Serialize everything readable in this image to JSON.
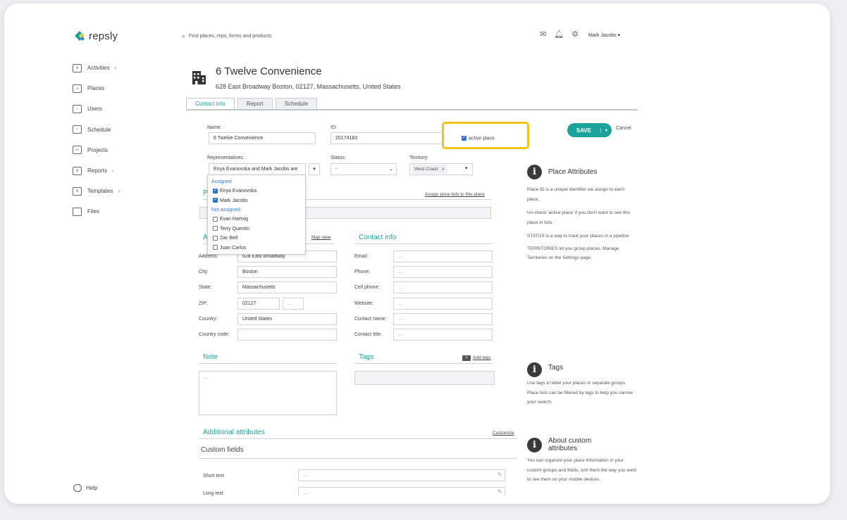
{
  "app": {
    "brand": "repsly",
    "accent": "#1aa39a",
    "highlight": "#f2c418"
  },
  "header": {
    "search_placeholder": "Find places, reps, forms and products",
    "icons": [
      "mail-icon",
      "bell-icon",
      "gear-icon"
    ],
    "user_name": "Mark Jacobs"
  },
  "sidebar": {
    "items": [
      {
        "label": "Activities",
        "chevron": "›"
      },
      {
        "label": "Places",
        "chevron": ""
      },
      {
        "label": "Users",
        "chevron": ""
      },
      {
        "label": "Schedule",
        "chevron": ""
      },
      {
        "label": "Projects",
        "chevron": ""
      },
      {
        "label": "Reports",
        "chevron": "›"
      },
      {
        "label": "Templates",
        "chevron": "›"
      },
      {
        "label": "Files",
        "chevron": ""
      }
    ],
    "help": "Help"
  },
  "place": {
    "title": "6 Twelve Convenience",
    "address": "628 East Broadway Boston, 02127, Massachusetts, United States"
  },
  "tabs": [
    "Contact info",
    "Report",
    "Schedule"
  ],
  "form": {
    "name_label": "Name:",
    "name_value": "6 Twelve Convenience",
    "id_label": "ID:",
    "id_value": "20174183",
    "active_label": "active place",
    "save_label": "SAVE",
    "cancel_label": "Cancel",
    "reps_label": "Representatives:",
    "reps_value": "Enya Evanovska and Mark Jacobs are",
    "status_label": "Status:",
    "status_value": "-",
    "territory_label": "Territory:",
    "territory_value": "West Coast",
    "territory_remove": "x",
    "assign_price_lists": "Assign price lists to this place",
    "map_view": "Map view",
    "address_label": "Address:",
    "address_value": "628 East Broadway",
    "city_label": "City:",
    "city_value": "Boston",
    "state_label": "State:",
    "state_value": "Massachusetts",
    "zip_label": "ZIP:",
    "zip_value": "02127",
    "zip_ext": "...",
    "country_label": "Country:",
    "country_value": "United States",
    "country_code_label": "Country code:",
    "contact_info_title": "Contact info",
    "email_label": "Email:",
    "phone_label": "Phone:",
    "cell_label": "Cell phone:",
    "website_label": "Website:",
    "contact_name_label": "Contact name:",
    "contact_title_label": "Contact title:",
    "placeholder": "...",
    "note_title": "Note",
    "tags_title": "Tags",
    "add_tags": "Add tags",
    "additional_title": "Additional attributes",
    "customize": "Customize",
    "custom_fields": "Custom fields",
    "short_text_label": "Short text",
    "long_text_label": "Long text"
  },
  "dropdown": {
    "assigned_header": "Assigned",
    "assigned": [
      "Enya Evanovska",
      "Mark Jacobs"
    ],
    "not_assigned_header": "Not assigned",
    "not_assigned": [
      "Evan Hartvig",
      "Terry Quentin",
      "Zac Bell",
      "Juan Carlos"
    ]
  },
  "info": {
    "attributes_title": "Place Attributes",
    "attributes_p1": "Place ID is a unique identifier we assign to each place.",
    "attributes_p2": "Un-check 'active place' if you don't want to see this place in lists.",
    "attributes_p3": "STATUS is a way to track your places in a pipeline",
    "attributes_p4": "TERRITORIES let you group places. Manage Territories on the Settings page.",
    "tags_title": "Tags",
    "tags_p": "Use tags to label your places in separate groups. Place lists can be filtered by tags to help you narrow your search.",
    "custom_title": "About custom attributes",
    "custom_p": "You can organize your place information in your custom groups and fields, sort them the way you want to see them on your mobile devices"
  }
}
